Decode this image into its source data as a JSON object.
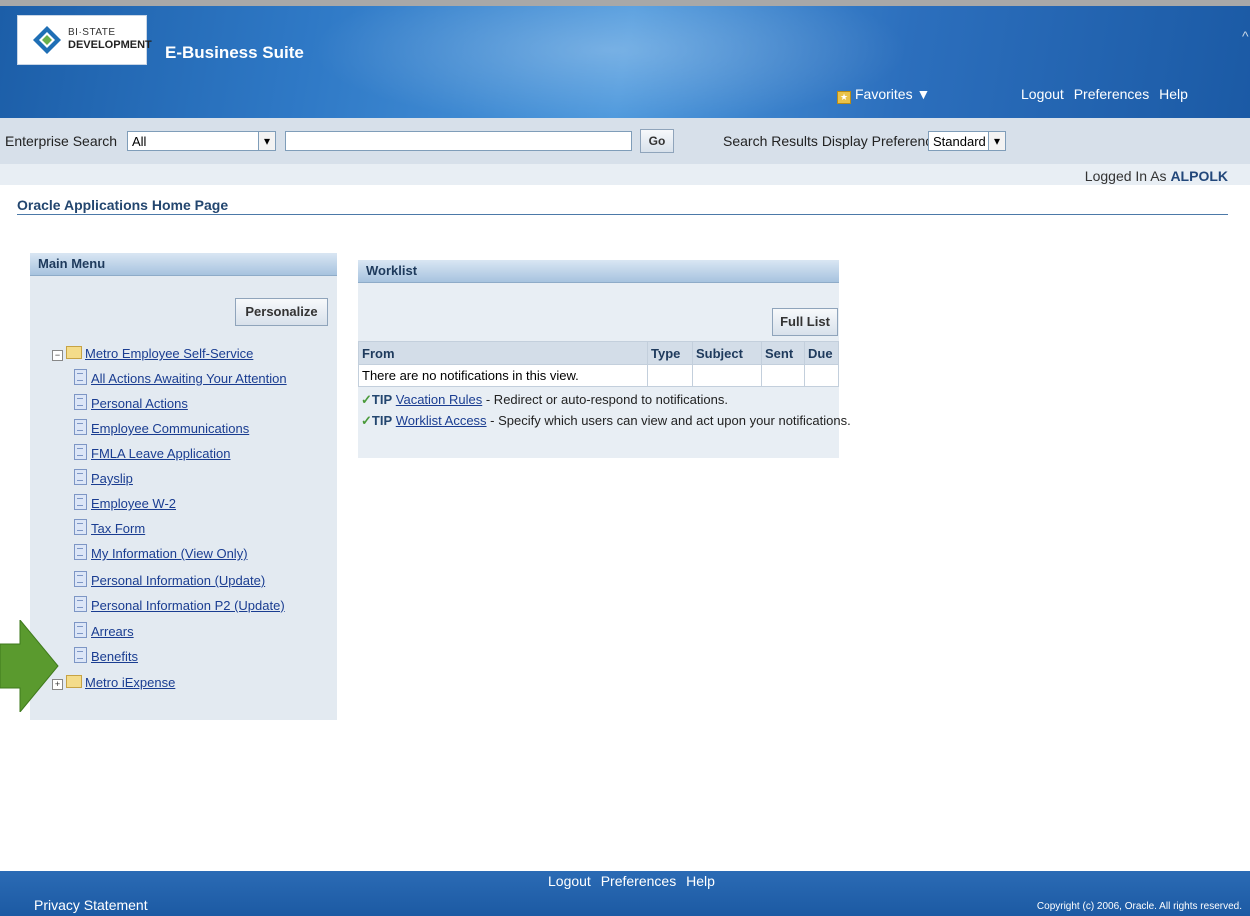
{
  "header": {
    "logo_line1": "BI·STATE",
    "logo_line2": "DEVELOPMENT",
    "app_title": "E-Business Suite",
    "favorites_label": "Favorites ▼",
    "links": [
      "Logout",
      "Preferences",
      "Help"
    ]
  },
  "search": {
    "label": "Enterprise Search",
    "scope_value": "All",
    "query_value": "",
    "go_label": "Go",
    "pref_label": "Search Results Display Preference",
    "pref_value": "Standard"
  },
  "session": {
    "logged_in_prefix": "Logged In As",
    "username": "ALPOLK"
  },
  "page": {
    "title": "Oracle Applications Home Page"
  },
  "main_menu": {
    "title": "Main Menu",
    "personalize_label": "Personalize",
    "folders": [
      {
        "label": "Metro Employee Self-Service",
        "expanded": true,
        "items": [
          "All Actions Awaiting Your Attention",
          "Personal Actions",
          "Employee Communications",
          "FMLA Leave Application",
          "Payslip",
          "Employee W-2",
          "Tax Form",
          "My Information (View Only)",
          "Personal Information (Update)",
          "Personal Information P2 (Update)",
          "Arrears",
          "Benefits"
        ]
      },
      {
        "label": "Metro iExpense",
        "expanded": false,
        "items": []
      }
    ]
  },
  "worklist": {
    "title": "Worklist",
    "full_list_label": "Full List",
    "columns": [
      "From",
      "Type",
      "Subject",
      "Sent",
      "Due"
    ],
    "empty_message": "There are no notifications in this view.",
    "tips": [
      {
        "tag": "TIP",
        "link": "Vacation Rules",
        "text": " - Redirect or auto-respond to notifications."
      },
      {
        "tag": "TIP",
        "link": "Worklist Access",
        "text": " - Specify which users can view and act upon your notifications."
      }
    ]
  },
  "footer": {
    "links": [
      "Logout",
      "Preferences",
      "Help"
    ],
    "privacy": "Privacy Statement",
    "copyright": "Copyright (c) 2006, Oracle. All rights reserved."
  },
  "colors": {
    "header_blue": "#2f79c6",
    "link_blue": "#1a3d91",
    "annotation_arrow": "#5a9a2e"
  }
}
